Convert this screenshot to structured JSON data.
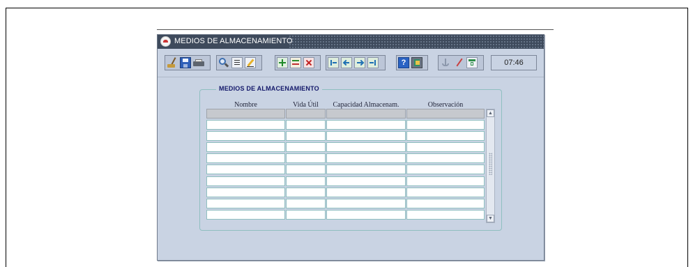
{
  "window": {
    "title": "MEDIOS DE ALMACENAMIENTO"
  },
  "toolbar": {
    "groups": [
      [
        "broom-icon",
        "save-icon",
        "print-icon"
      ],
      [
        "search-icon",
        "list-icon",
        "edit-icon"
      ],
      [
        "insert-record-icon",
        "duplicate-record-icon",
        "delete-record-icon"
      ],
      [
        "first-record-icon",
        "previous-record-icon",
        "next-record-icon",
        "last-record-icon"
      ],
      [
        "help-icon",
        "exit-icon"
      ],
      [
        "anchor-icon",
        "check-icon",
        "calendar-icon"
      ]
    ],
    "clock": "07:46"
  },
  "form": {
    "legend": "MEDIOS DE ALMACENAMIENTO",
    "columns": [
      "Nombre",
      "Vida Útil",
      "Capacidad Almacenam.",
      "Observación"
    ],
    "rows": [
      [
        "",
        "",
        "",
        ""
      ],
      [
        "",
        "",
        "",
        ""
      ],
      [
        "",
        "",
        "",
        ""
      ],
      [
        "",
        "",
        "",
        ""
      ],
      [
        "",
        "",
        "",
        ""
      ],
      [
        "",
        "",
        "",
        ""
      ],
      [
        "",
        "",
        "",
        ""
      ],
      [
        "",
        "",
        "",
        ""
      ],
      [
        "",
        "",
        "",
        ""
      ]
    ]
  }
}
